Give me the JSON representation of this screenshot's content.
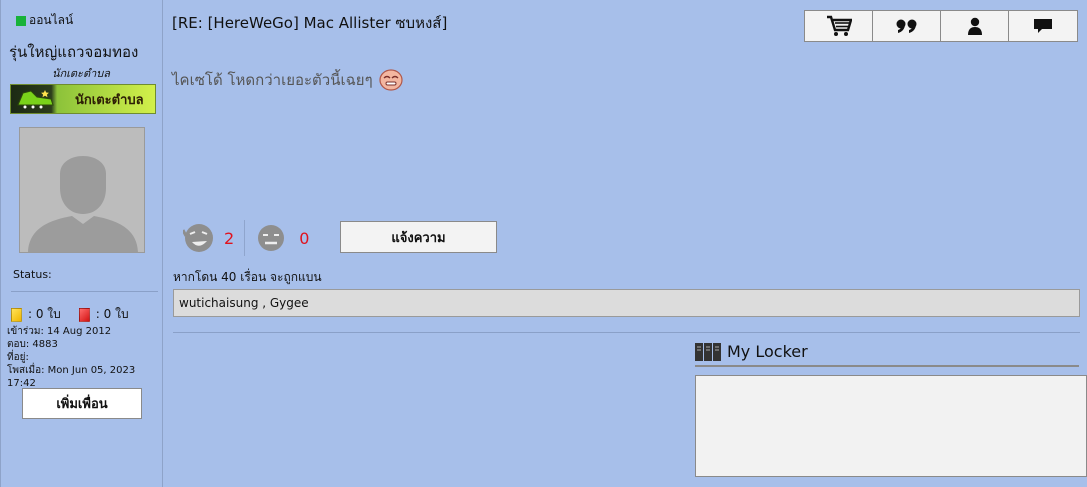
{
  "user": {
    "online_label": "ออนไลน์",
    "online_color": "#18b23a",
    "name": "รุ่นใหญ่แถวจอมทอง",
    "rank": "นักเตะตำบล",
    "rank_badge_text": "นักเตะตำบล",
    "status_label": "Status:",
    "yellow_cards": ": 0 ใบ",
    "red_cards": ": 0 ใบ",
    "joined": "เข้าร่วม: 14 Aug 2012",
    "replies": "ตอบ: 4883",
    "location": "ที่อยู่:",
    "posted": "โพสเมื่อ: Mon Jun 05, 2023 17:42",
    "add_friend_label": "เพิ่มเพื่อน"
  },
  "post": {
    "title": "[RE: [HereWeGo] Mac Allister ซบหงส์]",
    "body": "ไคเซโด้ โหดกว่าเยอะตัวนี้เฉยๆ",
    "like_count": "2",
    "dislike_count": "0",
    "report_label": "แจ้งความ",
    "rules_text": "หากโดน 40 เรื่อน จะถูกแบน",
    "liked_by": "wutichaisung , Gygee",
    "locker_title": "My Locker"
  },
  "toolbar": {
    "icons": [
      "cart-icon",
      "quote-icon",
      "profile-icon",
      "message-icon"
    ]
  },
  "colors": {
    "background": "#a7bfea",
    "count_red": "#e0121d"
  }
}
